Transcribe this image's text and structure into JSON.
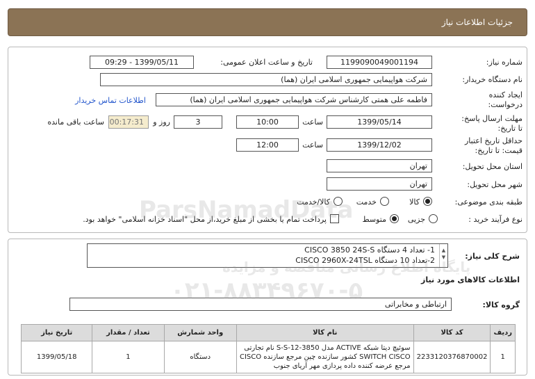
{
  "header": {
    "title": "جزئیات اطلاعات نیاز"
  },
  "fields": {
    "need_number_label": "شماره نیاز:",
    "need_number": "1199090049001194",
    "announce_label": "تاریخ و ساعت اعلان عمومی:",
    "announce_value": "1399/05/11 - 09:29",
    "buyer_label": "نام دستگاه خریدار:",
    "buyer_value": "شرکت هواپیمایی جمهوری اسلامی ایران (هما)",
    "creator_label_1": "ایجاد کننده",
    "creator_label_2": "درخواست:",
    "creator_value": "فاطمه علی همتی کارشناس شرکت هواپیمایی جمهوری اسلامی ایران (هما)",
    "contact_link": "اطلاعات تماس خریدار",
    "deadline_label_1": "مهلت ارسال پاسخ:",
    "deadline_label_2": "تا تاریخ:",
    "deadline_date": "1399/05/14",
    "time_label": "ساعت",
    "deadline_time": "10:00",
    "days_value": "3",
    "days_label": "روز و",
    "remaining_time": "00:17:31",
    "remaining_label": "ساعت باقی مانده",
    "validity_label_1": "حداقل تاریخ اعتبار",
    "validity_label_2": "قیمت: تا تاریخ:",
    "validity_date": "1399/12/02",
    "validity_time": "12:00",
    "province_label": "استان محل تحویل:",
    "province_value": "تهران",
    "city_label": "شهر محل تحویل:",
    "city_value": "تهران",
    "category_label": "طبقه بندی موضوعی:",
    "category_options": [
      "کالا",
      "خدمت",
      "کالا/خدمت"
    ],
    "purchase_label": "نوع فرآیند خرید :",
    "purchase_options": [
      "جزیی",
      "متوسط"
    ],
    "payment_text": "پرداخت تمام یا بخشی از مبلغ خرید،از محل \"اسناد خزانه اسلامی\" خواهد بود."
  },
  "description": {
    "label": "شرح کلی نیاز:",
    "line1": "1- تعداد 4 دستگاه CISCO 3850 24S-S",
    "line2": "2-تعداد 10 دستگاه CISCO 2960X-24TSL"
  },
  "goods_info_title": "اطلاعات کالاهای مورد نیاز",
  "goods_group": {
    "label": "گروه کالا:",
    "value": "ارتباطی و مخابراتی"
  },
  "table": {
    "headers": [
      "ردیف",
      "کد کالا",
      "نام کالا",
      "واحد شمارش",
      "تعداد / مقدار",
      "تاریخ نیاز"
    ],
    "row": {
      "index": "1",
      "code": "2233120376870002",
      "name_1": "سوئیچ دیتا شبکه ACTIVE مدل S-S-12-3850 نام تجارتی",
      "name_2": "SWITCH CISCO کشور سازنده چین مرجع سازنده CISCO",
      "name_3": "مرجع عرضه کننده داده پردازی مهر آریای جنوب",
      "unit": "دستگاه",
      "qty": "1",
      "date": "1399/05/18"
    }
  },
  "watermark": {
    "brand": "ParsNamadData",
    "line1": "پایگاه اطلاع رسانی مناقصه و مزایده",
    "phone": "۰۲۱-۸۸۳۴۹۶۷۰-۵"
  },
  "colors": {
    "header_bg": "#8b7355",
    "timer_bg": "#f5eccd",
    "link": "#2255cc"
  }
}
